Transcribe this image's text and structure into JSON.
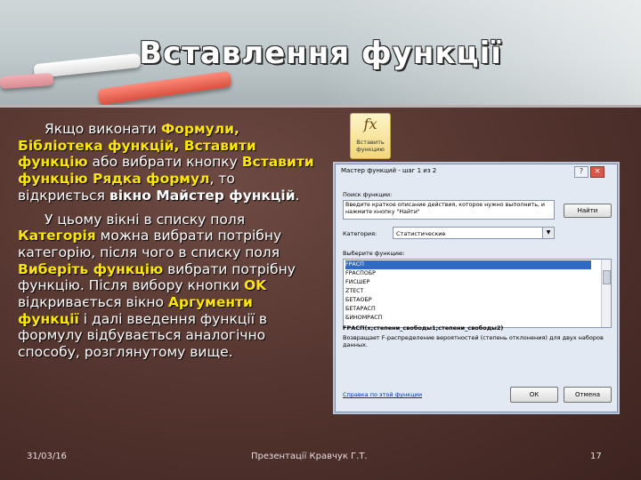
{
  "slide": {
    "title": "Вставлення функції",
    "para1": {
      "t1": "Якщо виконати ",
      "h1": "Формули, Бібліотека функцій, Вставити функцію",
      "t2": " або вибрати кнопку ",
      "h2": "Вставити функцію Рядка формул",
      "t3": ", то відкриється ",
      "b1": "вікно Майстер функцій",
      "t4": "."
    },
    "para2": {
      "t1": "У цьому вікні в списку поля ",
      "h1": "Категорія",
      "t2": " можна вибрати потрібну категорію, після чого в списку поля ",
      "h2": "Виберіть функцію",
      "t3": " вибрати потрібну функцію. Після вибору кнопки ",
      "h3": "OK",
      "t4": " відкривається вікно ",
      "h4": "Аргументи функції",
      "t5": " і далі введення функції в формулу відбувається аналогічно способу, розглянутому вище."
    },
    "footer": {
      "date": "31/03/16",
      "author": "Презентації Кравчук Г.Т.",
      "page": "17"
    }
  },
  "fx_button": {
    "symbol": "fx",
    "label": "Вставить функцию"
  },
  "dialog": {
    "title": "Мастер функций - шаг 1 из 2",
    "help_glyph": "?",
    "close_glyph": "✕",
    "search_label": "Поиск функции:",
    "search_value": "Введите краткое описание действия, которое нужно выполнить, и нажмите кнопку \"Найти\"",
    "find_button": "Найти",
    "category_label": "Категория:",
    "category_value": "Статистические",
    "select_label": "Выберите функцию:",
    "functions": [
      "FРАСП",
      "FРАСПОБР",
      "FИСШЕР",
      "ZТЕСТ",
      "БЕТАОБР",
      "БЕТАРАСП",
      "БИНОМРАСП"
    ],
    "signature": "FРАСП(x;степени_свободы1;степени_свободы2)",
    "description": "Возвращает F-распределение вероятностей (степень отклонения) для двух наборов данных.",
    "help_link": "Справка по этой функции",
    "ok_button": "ОК",
    "cancel_button": "Отмена"
  },
  "colors": {
    "highlight": "#ffe600",
    "text": "#ffffff",
    "selection": "#3169c6"
  }
}
